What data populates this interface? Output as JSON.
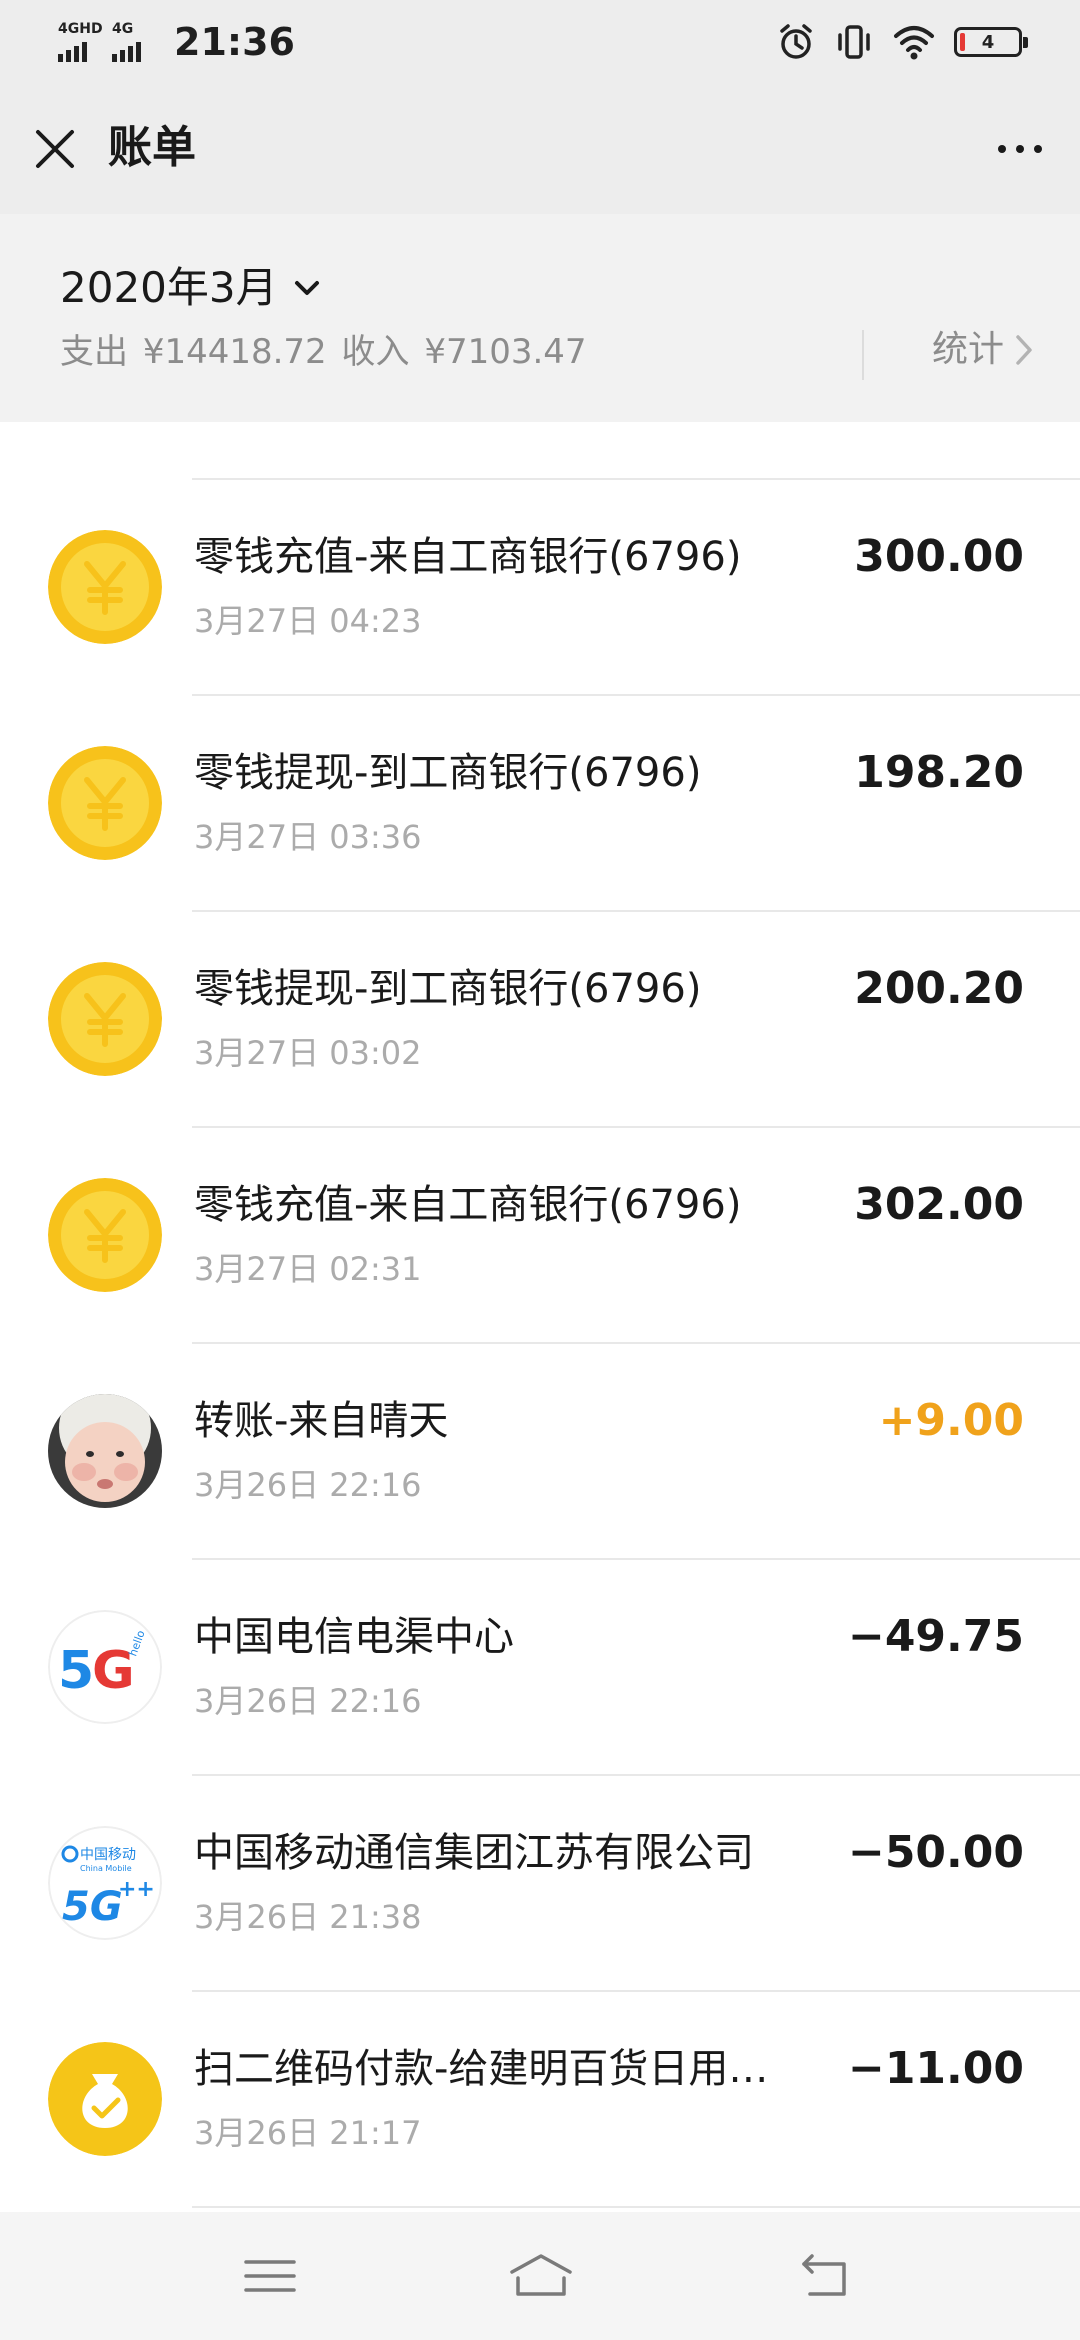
{
  "status_bar": {
    "network1": "4GHD",
    "network2": "4G",
    "time": "21:36",
    "battery_level": "4",
    "icons": [
      "alarm-icon",
      "vibrate-icon",
      "wifi-icon",
      "battery-icon"
    ]
  },
  "header": {
    "title": "账单",
    "close_icon": "close-icon",
    "more_icon": "more-icon"
  },
  "summary": {
    "month": "2020年3月",
    "expense_label": "支出",
    "expense_value": "¥14418.72",
    "income_label": "收入",
    "income_value": "¥7103.47",
    "stats_label": "统计"
  },
  "transactions": [
    {
      "title": "零钱充值-来自工商银行(6796)",
      "time": "3月27日 04:23",
      "amount": "300.00",
      "icon": "yuan-coin-icon",
      "type": "neutral"
    },
    {
      "title": "零钱提现-到工商银行(6796)",
      "time": "3月27日 03:36",
      "amount": "198.20",
      "icon": "yuan-coin-icon",
      "type": "neutral"
    },
    {
      "title": "零钱提现-到工商银行(6796)",
      "time": "3月27日 03:02",
      "amount": "200.20",
      "icon": "yuan-coin-icon",
      "type": "neutral"
    },
    {
      "title": "零钱充值-来自工商银行(6796)",
      "time": "3月27日 02:31",
      "amount": "302.00",
      "icon": "yuan-coin-icon",
      "type": "neutral"
    },
    {
      "title": "转账-来自晴天",
      "time": "3月26日 22:16",
      "amount": "+9.00",
      "icon": "baby-avatar",
      "type": "income"
    },
    {
      "title": "中国电信电渠中心",
      "time": "3月26日 22:16",
      "amount": "−49.75",
      "icon": "china-telecom-5g-logo",
      "type": "expense"
    },
    {
      "title": "中国移动通信集团江苏有限公司",
      "time": "3月26日 21:38",
      "amount": "−50.00",
      "icon": "china-mobile-5g-logo",
      "type": "expense"
    },
    {
      "title": "扫二维码付款-给建明百货日用…",
      "time": "3月26日 21:17",
      "amount": "−11.00",
      "icon": "money-bag-icon",
      "type": "expense"
    }
  ],
  "logo_text": {
    "telecom_5g": "5G",
    "telecom_hello": "hello",
    "mobile_cn": "中国移动",
    "mobile_en": "China Mobile",
    "mobile_5g": "5G",
    "mobile_plus": "++"
  },
  "colors": {
    "coin_yellow": "#f7c21b",
    "income_amount": "#f0a21b",
    "header_bg": "#ededed"
  },
  "bottom_nav": [
    "menu-icon",
    "home-icon",
    "back-icon"
  ]
}
